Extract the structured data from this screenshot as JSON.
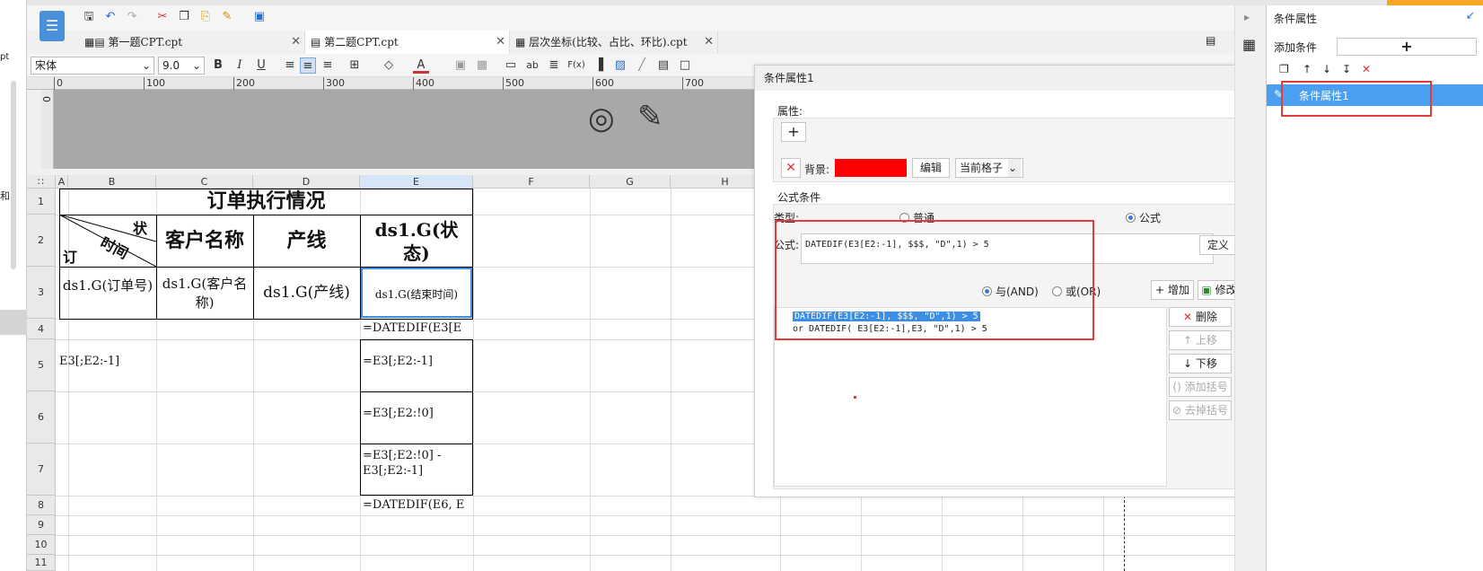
{
  "toolbar": {
    "font_name": "宋体",
    "font_size": "9.0",
    "bold": "B",
    "italic": "I",
    "underline": "U",
    "text_a": "A",
    "text_ab": "ab",
    "text_fx": "F(x)"
  },
  "tabs": [
    {
      "label": "第一题CPT.cpt"
    },
    {
      "label": "第二题CPT.cpt"
    },
    {
      "label": "层次坐标(比较、占比、环比).cpt"
    }
  ],
  "ruler": {
    "marks": [
      "0",
      "100",
      "200",
      "300",
      "400",
      "500",
      "600",
      "700"
    ],
    "v0": "0"
  },
  "grid": {
    "columns": [
      "A",
      "B",
      "C",
      "D",
      "E",
      "F",
      "G",
      "H"
    ],
    "rows": [
      "1",
      "2",
      "3",
      "4",
      "5",
      "6",
      "7",
      "8",
      "9",
      "10",
      "11"
    ],
    "title": "订单执行情况",
    "diag_top": "状",
    "diag_mid": "时间",
    "diag_bottom": "订",
    "h_customer": "客户名称",
    "h_line": "产线",
    "h_status": "ds1.G(状态)",
    "r3_order": "ds1.G(订单号)",
    "r3_customer": "ds1.G(客户名称)",
    "r3_line": "ds1.G(产线)",
    "r3_end": "ds1.G(结束时间)",
    "e4": "=DATEDIF(E3[E",
    "b5": "E3[;E2:-1]",
    "e5": "=E3[;E2:-1]",
    "e6": "=E3[;E2:!0]",
    "e7": "=E3[;E2:!0] - E3[;E2:-1]",
    "e8": "=DATEDIF(E6, E"
  },
  "dialog": {
    "title": "条件属性1",
    "attr_label": "属性:",
    "bg_label": "背景:",
    "bg_color": "#ff0000",
    "edit_btn": "编辑",
    "scope": "当前格子",
    "formula_section": "公式条件",
    "type_label": "类型:",
    "type_normal": "普通",
    "type_formula": "公式",
    "formula_label": "公式:",
    "formula_value": "DATEDIF(E3[E2:-1], $$$, \"D\",1) > 5",
    "define_btn": "定义",
    "and_label": "与(AND)",
    "or_label": "或(OR)",
    "add_btn": "增加",
    "modify_btn": "修改",
    "cond_line1": "DATEDIF(E3[E2:-1], $$$, \"D\",1) > 5",
    "cond_line2": "or  DATEDIF( E3[E2:-1],E3, \"D\",1) > 5",
    "delete_btn": "删除",
    "up_btn": "上移",
    "down_btn": "下移",
    "add_paren_btn": "添加括号",
    "remove_paren_btn": "去掉括号"
  },
  "right_panel": {
    "title": "条件属性",
    "add_condition": "添加条件",
    "plus": "+",
    "item": "条件属性1"
  },
  "left_strip": {
    "t1": "pt",
    "t2": "和"
  },
  "colors": {
    "accent": "#3a8ee6",
    "highlight": "#e43b3b",
    "selected_item": "#4a9ff0"
  }
}
